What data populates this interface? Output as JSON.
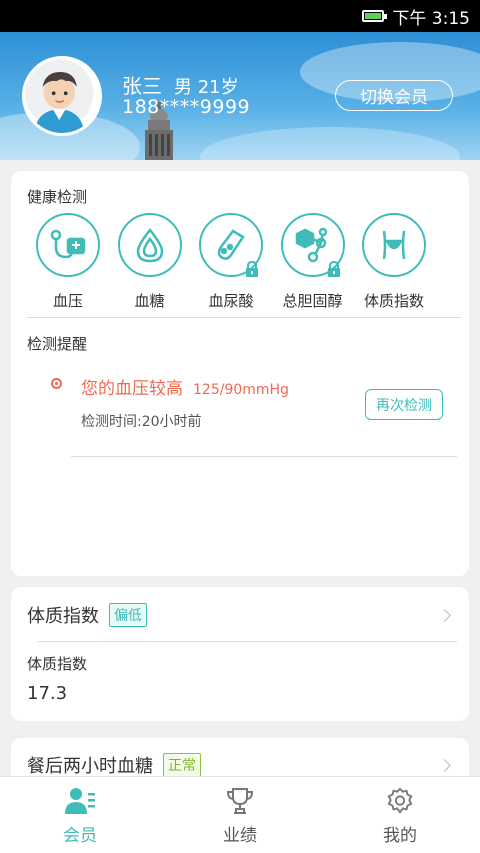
{
  "status_bar": {
    "time": "下午 3:15",
    "battery": "battery-icon"
  },
  "member": {
    "name": "张三",
    "gender_age": "男 21岁",
    "phone": "188****9999",
    "switch_label": "切换会员"
  },
  "health_check": {
    "title": "健康检测",
    "items": [
      {
        "label": "血压",
        "icon": "blood-pressure-icon",
        "locked": false
      },
      {
        "label": "血糖",
        "icon": "blood-drop-icon",
        "locked": false
      },
      {
        "label": "血尿酸",
        "icon": "flask-icon",
        "locked": true
      },
      {
        "label": "总胆固醇",
        "icon": "molecule-icon",
        "locked": true
      },
      {
        "label": "体质指数",
        "icon": "body-icon",
        "locked": false
      }
    ]
  },
  "reminder": {
    "title": "检测提醒",
    "message": "您的血压较高",
    "value": "125/90mmHg",
    "time": "检测时间:20小时前",
    "recheck_label": "再次检测"
  },
  "bmi_card": {
    "title": "体质指数",
    "badge": "偏低",
    "metric_label": "体质指数",
    "metric_value": "17.3"
  },
  "glucose_card": {
    "title": "餐后两小时血糖",
    "badge": "正常"
  },
  "tabs": [
    {
      "label": "会员",
      "icon": "member-icon",
      "active": true
    },
    {
      "label": "业绩",
      "icon": "trophy-icon",
      "active": false
    },
    {
      "label": "我的",
      "icon": "settings-icon",
      "active": false
    }
  ],
  "colors": {
    "accent": "#3fbcb7",
    "alert": "#f06a4f",
    "header": "#2d8fd6",
    "normal": "#8cc63f"
  }
}
